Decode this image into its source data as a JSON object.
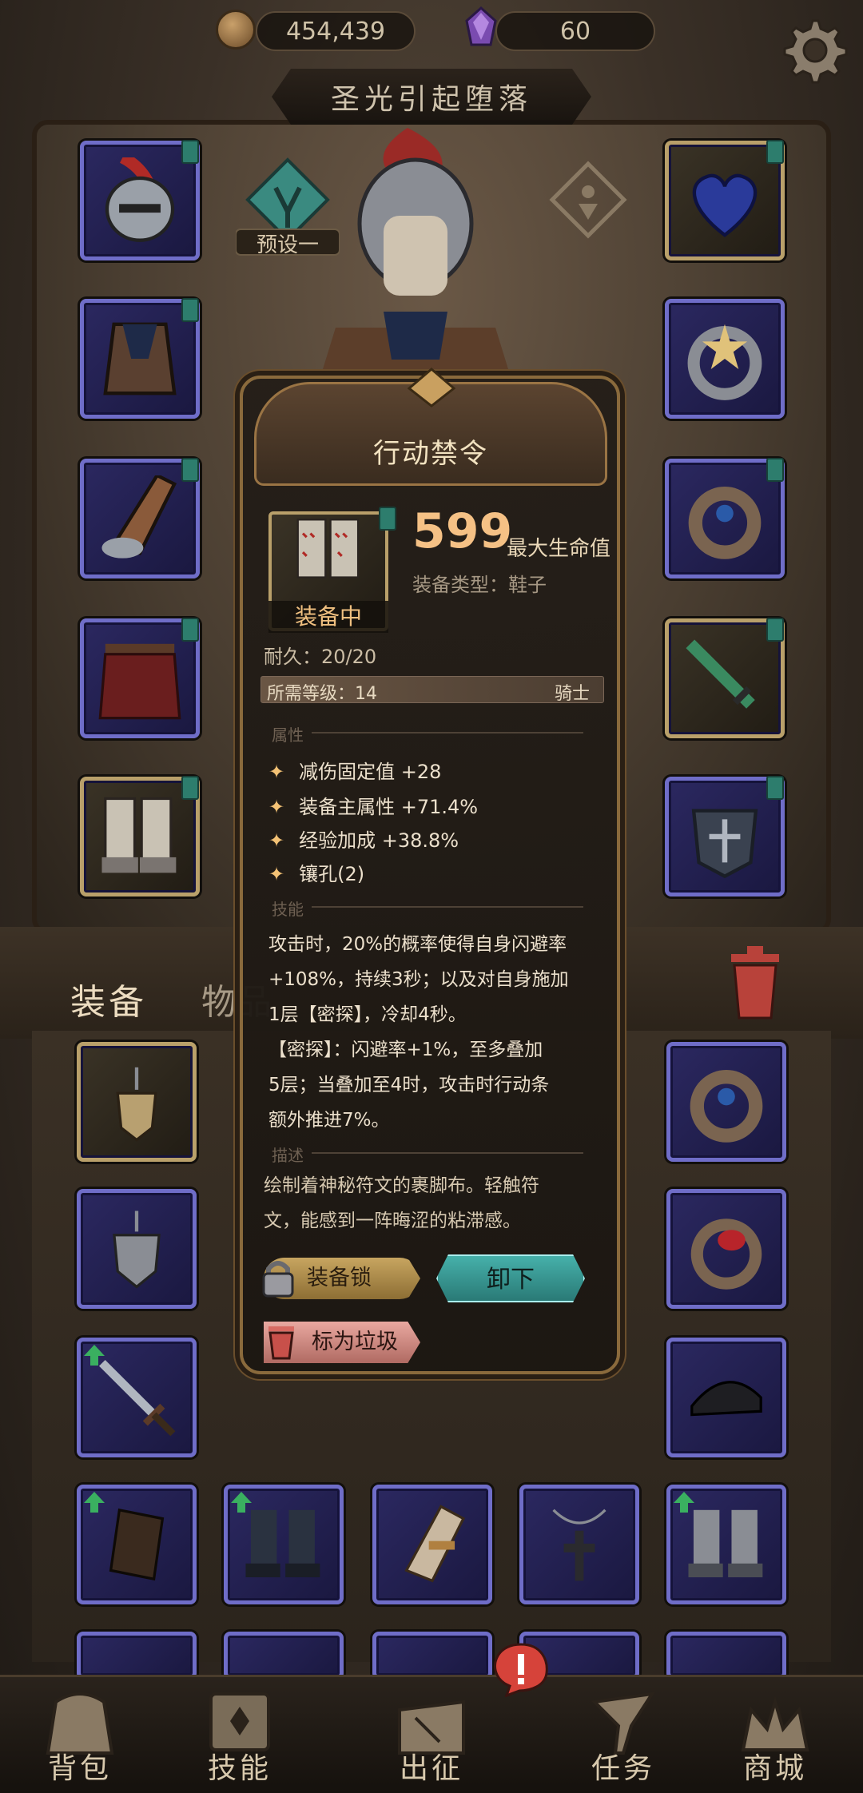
{
  "topbar": {
    "coins": "454,439",
    "gems": "60",
    "settings_icon": "gear-icon"
  },
  "title": "圣光引起堕落",
  "preset": {
    "label": "预设一",
    "icon": "rune-shield-icon"
  },
  "equipment_slots": {
    "left": [
      "helmet-icon",
      "cloak-icon",
      "gauntlet-icon",
      "skirt-armor-icon",
      "boots-icon"
    ],
    "right": [
      "heart-necklace-icon",
      "star-ring-icon",
      "owl-ring-icon",
      "green-sword-icon",
      "helmet-shield-icon"
    ]
  },
  "tabs": {
    "equipment": "装备",
    "items": "物品"
  },
  "tooltip": {
    "name": "行动禁令",
    "equipped_label": "装备中",
    "main_stat_value": "599",
    "main_stat_label": "最大生命值",
    "type": "装备类型：鞋子",
    "durability": "耐久：20/20",
    "required_level": "所需等级：14",
    "class": "骑士",
    "sections": {
      "attributes": "属性",
      "skill": "技能",
      "description": "描述"
    },
    "attributes": [
      "减伤固定值 +28",
      "装备主属性 +71.4%",
      "经验加成 +38.8%",
      "镶孔(2)"
    ],
    "skill_lines": [
      "攻击时，20%的概率使得自身闪避率",
      "+108%，持续3秒；以及对自身施加",
      "1层【密探】，冷却4秒。",
      "【密探】：闪避率+1%，至多叠加",
      "5层；当叠加至4时，攻击时行动条",
      "额外推进7%。"
    ],
    "description_lines": [
      "绘制着神秘符文的裹脚布。轻触符",
      "文，能感到一阵晦涩的粘滞感。"
    ],
    "buttons": {
      "lock": "装备锁",
      "unequip": "卸下",
      "mark_trash": "标为垃圾"
    }
  },
  "nav": [
    {
      "label": "背包",
      "icon": "backpack-icon"
    },
    {
      "label": "技能",
      "icon": "skill-book-icon"
    },
    {
      "label": "出征",
      "icon": "map-scroll-icon"
    },
    {
      "label": "任务",
      "icon": "quest-horn-icon"
    },
    {
      "label": "商城",
      "icon": "shop-crown-icon"
    }
  ],
  "colors": {
    "slot_border": "#6f6dc8",
    "gold_border": "#b9a06a",
    "stat_orange": "#f5c185",
    "unequip_teal": "#46b0aa",
    "trash_pink": "#e9a8a0"
  }
}
